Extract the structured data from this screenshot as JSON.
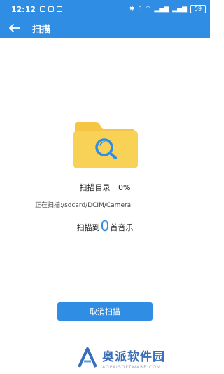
{
  "status_bar": {
    "time": "12:12",
    "battery": "59"
  },
  "header": {
    "title": "扫描"
  },
  "scan": {
    "title": "扫描目录",
    "percent": "0%",
    "path_label": "正在扫描:/sdcard/DCIM/Camera",
    "count_prefix": "扫描到",
    "count": "0",
    "count_suffix": "首音乐"
  },
  "actions": {
    "cancel_label": "取消扫描"
  },
  "watermark": {
    "name": "奥派软件园",
    "url": "AOPAISOFTWARE.COM"
  },
  "colors": {
    "primary": "#2f8de4",
    "folder": "#f7d257",
    "folder_tab": "#f4c643"
  }
}
